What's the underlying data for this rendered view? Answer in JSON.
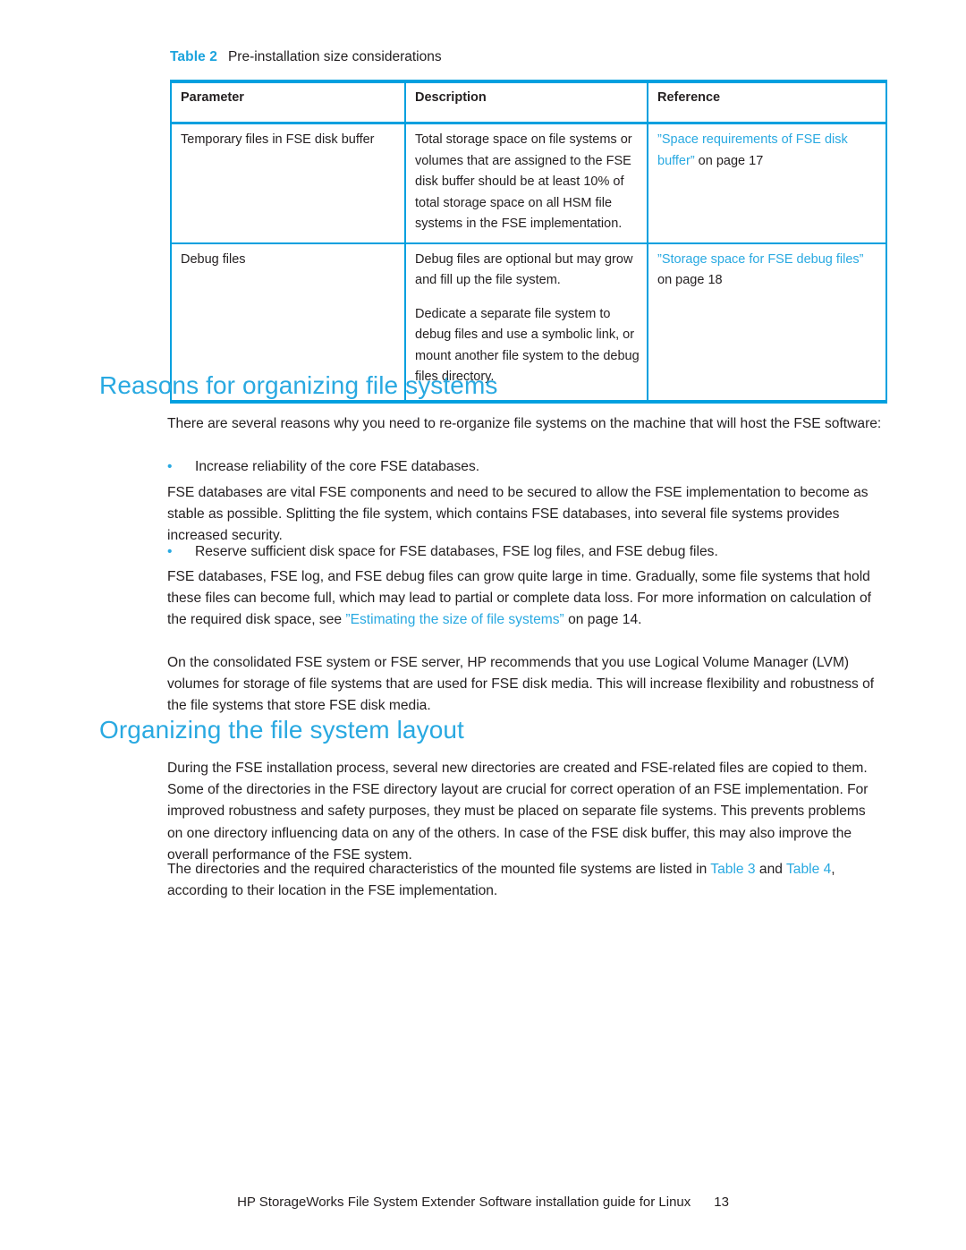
{
  "document": {
    "footer_title": "HP StorageWorks File System Extender Software installation guide for Linux",
    "footer_page": "13"
  },
  "colors": {
    "accent_cyan": "#29a9e1",
    "table_border": "#00a0df",
    "body_text": "#231f20"
  },
  "table": {
    "caption_label": "Table 2",
    "caption_text": "Pre-installation size considerations",
    "headers": [
      "Parameter",
      "Description",
      "Reference"
    ],
    "rows": [
      {
        "parameter": "Temporary files in FSE disk buffer",
        "description": "Total storage space on file systems or volumes that are assigned to the FSE disk buffer should be at least 10% of total storage space on all HSM file systems in the FSE implementation.",
        "reference_link": "”Space requirements of FSE disk buffer”",
        "reference_tail": " on page 17"
      },
      {
        "parameter": "Debug files",
        "description_p1": "Debug files are optional but may grow and fill up the file system.",
        "description_p2": "Dedicate a separate file system to debug files and use a symbolic link, or mount another file system to the debug files directory.",
        "reference_link": "”Storage space for FSE debug files”",
        "reference_tail": " on page 18"
      }
    ]
  },
  "sections": [
    {
      "heading": "Reasons for organizing file systems",
      "intro": "There are several reasons why you need to re-organize file systems on the machine that will host the FSE software:",
      "bullet_1": "Increase reliability of the core FSE databases.",
      "body_1": "FSE databases are vital FSE components and need to be secured to allow the FSE implementation to become as stable as possible. Splitting the file system, which contains FSE databases, into several file systems provides increased security.",
      "bullet_2": "Reserve sufficient disk space for FSE databases, FSE log files, and FSE debug files.",
      "body_2_pre": "FSE databases, FSE log, and FSE debug files can grow quite large in time. Gradually, some file systems that hold these files can become full, which may lead to partial or complete data loss. For more information on calculation of the required disk space, see ",
      "body_2_link": "”Estimating the size of file systems”",
      "body_2_post": " on page 14.",
      "body_3": "On the consolidated FSE system or FSE server, HP recommends that you use Logical Volume Manager (LVM) volumes for storage of file systems that are used for FSE disk media. This will increase flexibility and robustness of the file systems that store FSE disk media."
    },
    {
      "heading": "Organizing the file system layout",
      "body_1": "During the FSE installation process, several new directories are created and FSE-related files are copied to them. Some of the directories in the FSE directory layout are crucial for correct operation of an FSE implementation. For improved robustness and safety purposes, they must be placed on separate file systems. This prevents problems on one directory influencing data on any of the others. In case of the FSE disk buffer, this may also improve the overall performance of the FSE system.",
      "body_2_pre": "The directories and the required characteristics of the mounted file systems are listed in ",
      "body_2_link1": "Table 3",
      "body_2_mid": " and ",
      "body_2_link2": "Table 4",
      "body_2_post": ", according to their location in the FSE implementation."
    }
  ],
  "bullet_glyph": "•"
}
